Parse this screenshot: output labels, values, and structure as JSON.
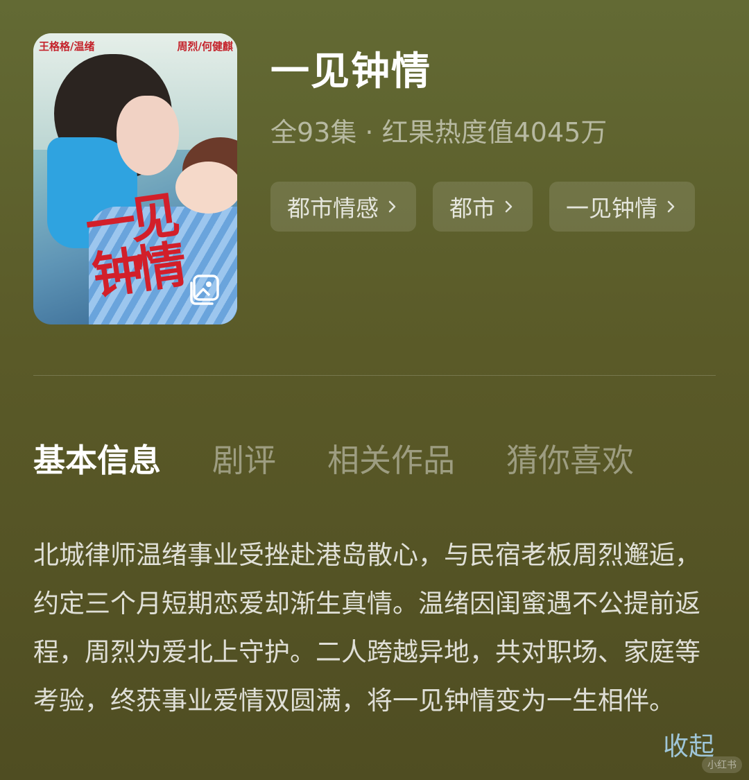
{
  "poster": {
    "cast_left": "王格格/温绪",
    "cast_right": "周烈/何健麒",
    "calligraphy": "一见钟情",
    "gallery_icon": "gallery-icon"
  },
  "drama": {
    "title": "一见钟情",
    "meta": "全93集 · 红果热度值4045万"
  },
  "tags": [
    {
      "label": "都市情感"
    },
    {
      "label": "都市"
    },
    {
      "label": "一见钟情"
    }
  ],
  "tabs": [
    {
      "label": "基本信息"
    },
    {
      "label": "剧评"
    },
    {
      "label": "相关作品"
    },
    {
      "label": "猜你喜欢"
    }
  ],
  "description": "北城律师温绪事业受挫赴港岛散心，与民宿老板周烈邂逅，约定三个月短期恋爱却渐生真情。温绪因闺蜜遇不公提前返程，周烈为爱北上守护。二人跨越异地，共对职场、家庭等考验，终获事业爱情双圆满，将一见钟情变为一生相伴。",
  "collapse_label": "收起",
  "watermark": "小红书",
  "colors": {
    "accent_link": "#9fc6d9",
    "background": "#5e6230"
  }
}
